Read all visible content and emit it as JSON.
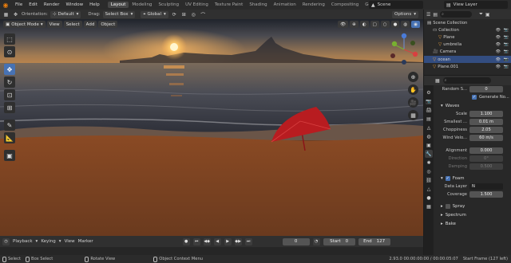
{
  "topbar": {
    "menus": [
      "File",
      "Edit",
      "Render",
      "Window",
      "Help"
    ],
    "workspaces": [
      "Layout",
      "Modeling",
      "Sculpting",
      "UV Editing",
      "Texture Paint",
      "Shading",
      "Animation",
      "Rendering",
      "Compositing",
      "Geometry Nod"
    ],
    "active_workspace": "Layout",
    "scene": "Scene",
    "view_layer": "View Layer"
  },
  "header": {
    "orientation_label": "Orientation:",
    "orientation_value": "Default",
    "drag_label": "Drag:",
    "drag_value": "Select Box",
    "pivot_value": "Global",
    "options_label": "Options"
  },
  "viewport": {
    "mode": "Object Mode",
    "menus": [
      "View",
      "Select",
      "Add",
      "Object"
    ]
  },
  "timeline": {
    "playback": "Playback",
    "keying": "Keying",
    "view": "View",
    "marker": "Marker",
    "current_frame": "0",
    "start_label": "Start",
    "start": "0",
    "end_label": "End",
    "end": "127"
  },
  "statusbar": {
    "select": "Select",
    "box_select": "Box Select",
    "rotate_view": "Rotate View",
    "context_menu": "Object Context Menu",
    "version_stats": "2.93.0  00:00:00:00 / 00:00:05:07",
    "start_frame": "Start Frame (127 left)"
  },
  "outliner": {
    "rows": [
      {
        "label": "Scene Collection",
        "indent": 0,
        "icon": "scene-collection-icon",
        "selected": false
      },
      {
        "label": "Collection",
        "indent": 1,
        "icon": "collection-icon",
        "selected": false
      },
      {
        "label": "Plane",
        "indent": 2,
        "icon": "mesh-icon",
        "selected": false
      },
      {
        "label": "umbrella",
        "indent": 2,
        "icon": "mesh-icon",
        "selected": false
      },
      {
        "label": "Camera",
        "indent": 1,
        "icon": "camera-icon",
        "selected": false
      },
      {
        "label": "ocean",
        "indent": 1,
        "icon": "mesh-icon",
        "selected": true
      },
      {
        "label": "Plane.001",
        "indent": 1,
        "icon": "mesh-icon",
        "selected": false
      }
    ]
  },
  "properties": {
    "random_seed_label": "Random S...",
    "random_seed": "0",
    "generate_normals": "Generate No...",
    "waves_section": "Waves",
    "scale_label": "Scale",
    "scale": "1.100",
    "smallest_label": "Smallest ...",
    "smallest": "0.01 m",
    "choppiness_label": "Choppiness",
    "choppiness": "2.05",
    "wind_label": "Wind Velo...",
    "wind": "60 m/s",
    "alignment_label": "Alignment",
    "alignment": "0.000",
    "direction_label": "Direction",
    "direction": "0°",
    "damping_label": "Damping",
    "damping": "0.500",
    "foam_section": "Foam",
    "data_layer_label": "Data Layer",
    "data_layer": "N",
    "coverage_label": "Coverage",
    "coverage": "1.500",
    "spray_section": "Spray",
    "spectrum_section": "Spectrum",
    "bake_section": "Bake"
  },
  "colors": {
    "accent": "#4772b3",
    "brand": "#e87d0d",
    "selection": "#334d80"
  }
}
